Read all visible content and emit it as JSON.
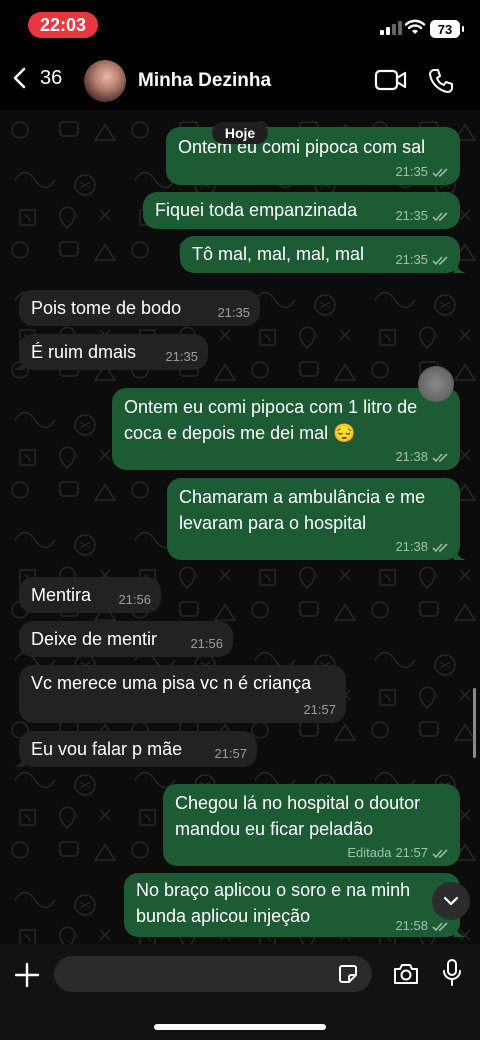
{
  "status_bar": {
    "time": "22:03",
    "battery": "73"
  },
  "header": {
    "back_count": "36",
    "contact_name": "Minha Dezinha"
  },
  "chat": {
    "date_chip": "Hoje",
    "messages": [
      {
        "dir": "out",
        "lines": [
          "Ontem eu comi pipoca com sal"
        ],
        "time": "21:35",
        "edited": ""
      },
      {
        "dir": "out",
        "lines": [
          "Fiquei toda empanzinada"
        ],
        "time": "21:35",
        "edited": ""
      },
      {
        "dir": "out",
        "lines": [
          "Tô mal, mal, mal, mal"
        ],
        "time": "21:35",
        "edited": ""
      },
      {
        "dir": "in",
        "lines": [
          "Pois tome de bodo"
        ],
        "time": "21:35",
        "edited": ""
      },
      {
        "dir": "in",
        "lines": [
          "É ruim dmais"
        ],
        "time": "21:35",
        "edited": ""
      },
      {
        "dir": "out",
        "lines": [
          "Ontem eu comi pipoca com 1 litro de",
          "coca e depois me dei mal 😔"
        ],
        "time": "21:38",
        "edited": ""
      },
      {
        "dir": "out",
        "lines": [
          "Chamaram a ambulância e me",
          "levaram para o hospital"
        ],
        "time": "21:38",
        "edited": ""
      },
      {
        "dir": "in",
        "lines": [
          "Mentira"
        ],
        "time": "21:56",
        "edited": ""
      },
      {
        "dir": "in",
        "lines": [
          "Deixe de mentir"
        ],
        "time": "21:56",
        "edited": ""
      },
      {
        "dir": "in",
        "lines": [
          "Vc merece uma pisa vc n é criança"
        ],
        "time": "21:57",
        "edited": ""
      },
      {
        "dir": "in",
        "lines": [
          "Eu vou falar p mãe"
        ],
        "time": "21:57",
        "edited": ""
      },
      {
        "dir": "out",
        "lines": [
          "Chegou lá no hospital o doutor",
          "mandou eu ficar peladão"
        ],
        "time": "21:57",
        "edited": "Editada"
      },
      {
        "dir": "out",
        "lines": [
          "No braço aplicou o soro e na minh",
          "bunda aplicou injeção"
        ],
        "time": "21:58",
        "edited": ""
      }
    ]
  },
  "input_bar": {
    "placeholder": ""
  },
  "colors": {
    "outgoing_bubble": "#1c5b34",
    "incoming_bubble": "#222222",
    "read_ticks": "#9fb8a8",
    "time_pill": "#e8373e"
  }
}
